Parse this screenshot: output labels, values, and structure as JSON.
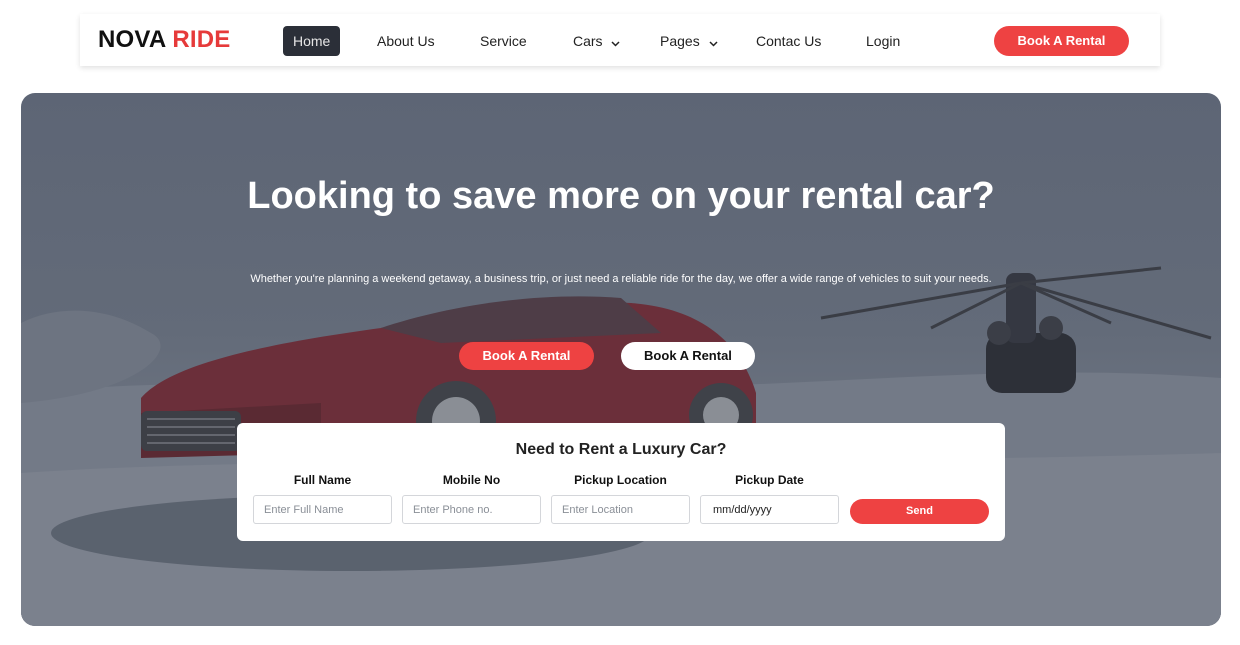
{
  "brand": {
    "part1": "NOVA",
    "part2": "RIDE"
  },
  "nav": {
    "items": [
      {
        "label": "Home",
        "active": true
      },
      {
        "label": "About Us"
      },
      {
        "label": "Service"
      },
      {
        "label": "Cars",
        "dropdown": true
      },
      {
        "label": "Pages",
        "dropdown": true
      },
      {
        "label": "Contac Us"
      },
      {
        "label": "Login"
      }
    ],
    "cta_label": "Book A Rental"
  },
  "hero": {
    "title": "Looking to save more on your rental car?",
    "subtitle": "Whether you're planning a weekend getaway, a business trip, or just need a reliable ride for the day, we offer a wide range of vehicles to suit your needs.",
    "primary_button": "Book A Rental",
    "secondary_button": "Book A Rental"
  },
  "form": {
    "title": "Need to Rent a Luxury Car?",
    "fields": [
      {
        "label": "Full Name",
        "placeholder": "Enter Full Name"
      },
      {
        "label": "Mobile No",
        "placeholder": "Enter Phone no."
      },
      {
        "label": "Pickup Location",
        "placeholder": "Enter Location"
      },
      {
        "label": "Pickup Date",
        "value": "mm/dd/yyyy"
      }
    ],
    "send_label": "Send"
  },
  "colors": {
    "accent": "#ee4242",
    "dark": "#2b2f38",
    "hero_overlay": "#5d6575"
  },
  "icons": {
    "dropdown": "chevron-down-icon"
  }
}
